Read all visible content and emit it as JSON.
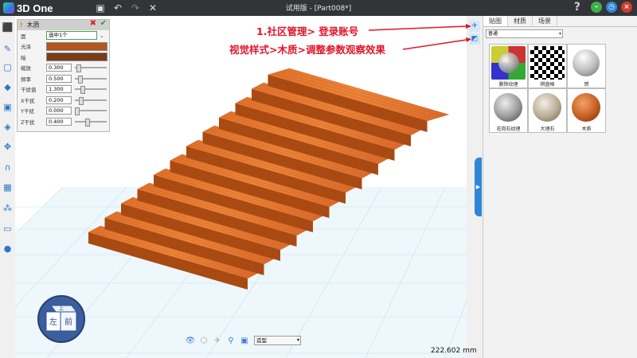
{
  "app": {
    "logo_text": "3D One",
    "title": "试用版 - [Part008*]",
    "help_label": "?"
  },
  "property_panel": {
    "title": "木质",
    "rows": {
      "face": {
        "label": "面",
        "value": "选中1个"
      },
      "gloss": {
        "label": "光泽",
        "color": "#b3561f"
      },
      "dark": {
        "label": "暗",
        "color": "#7a3d17"
      },
      "scale": {
        "label": "缩放",
        "value": "0.300"
      },
      "frequency": {
        "label": "频率",
        "value": "0.500"
      },
      "interference": {
        "label": "干扰值",
        "value": "1.300"
      },
      "x_interference": {
        "label": "X干扰",
        "value": "0.200"
      },
      "y_interference": {
        "label": "Y干扰",
        "value": "0.000"
      },
      "z_interference": {
        "label": "Z干扰",
        "value": "0.400"
      }
    }
  },
  "annotations": {
    "line1": "1.社区管理> 登录账号",
    "line2": "视觉样式>木质>调整参数观察效果"
  },
  "material_panel": {
    "tabs": [
      "贴图",
      "材质",
      "场景"
    ],
    "active_tab": "贴图",
    "dropdown": "普通",
    "thumbnails": [
      {
        "label": "删除纹理"
      },
      {
        "label": "棋盘格"
      },
      {
        "label": "锈"
      },
      {
        "label": "花岗石纹理"
      },
      {
        "label": "大理石"
      },
      {
        "label": "木质"
      }
    ]
  },
  "view_cube": {
    "left": "左",
    "front": "前",
    "top": "上"
  },
  "bottom_toolbar": {
    "mode": "造型"
  },
  "measure": "222.602 mm",
  "colors": {
    "wood_top": "#e7782c",
    "wood_side": "#a84a12",
    "accent": "#2f86d8",
    "annotation": "#e3142b"
  }
}
